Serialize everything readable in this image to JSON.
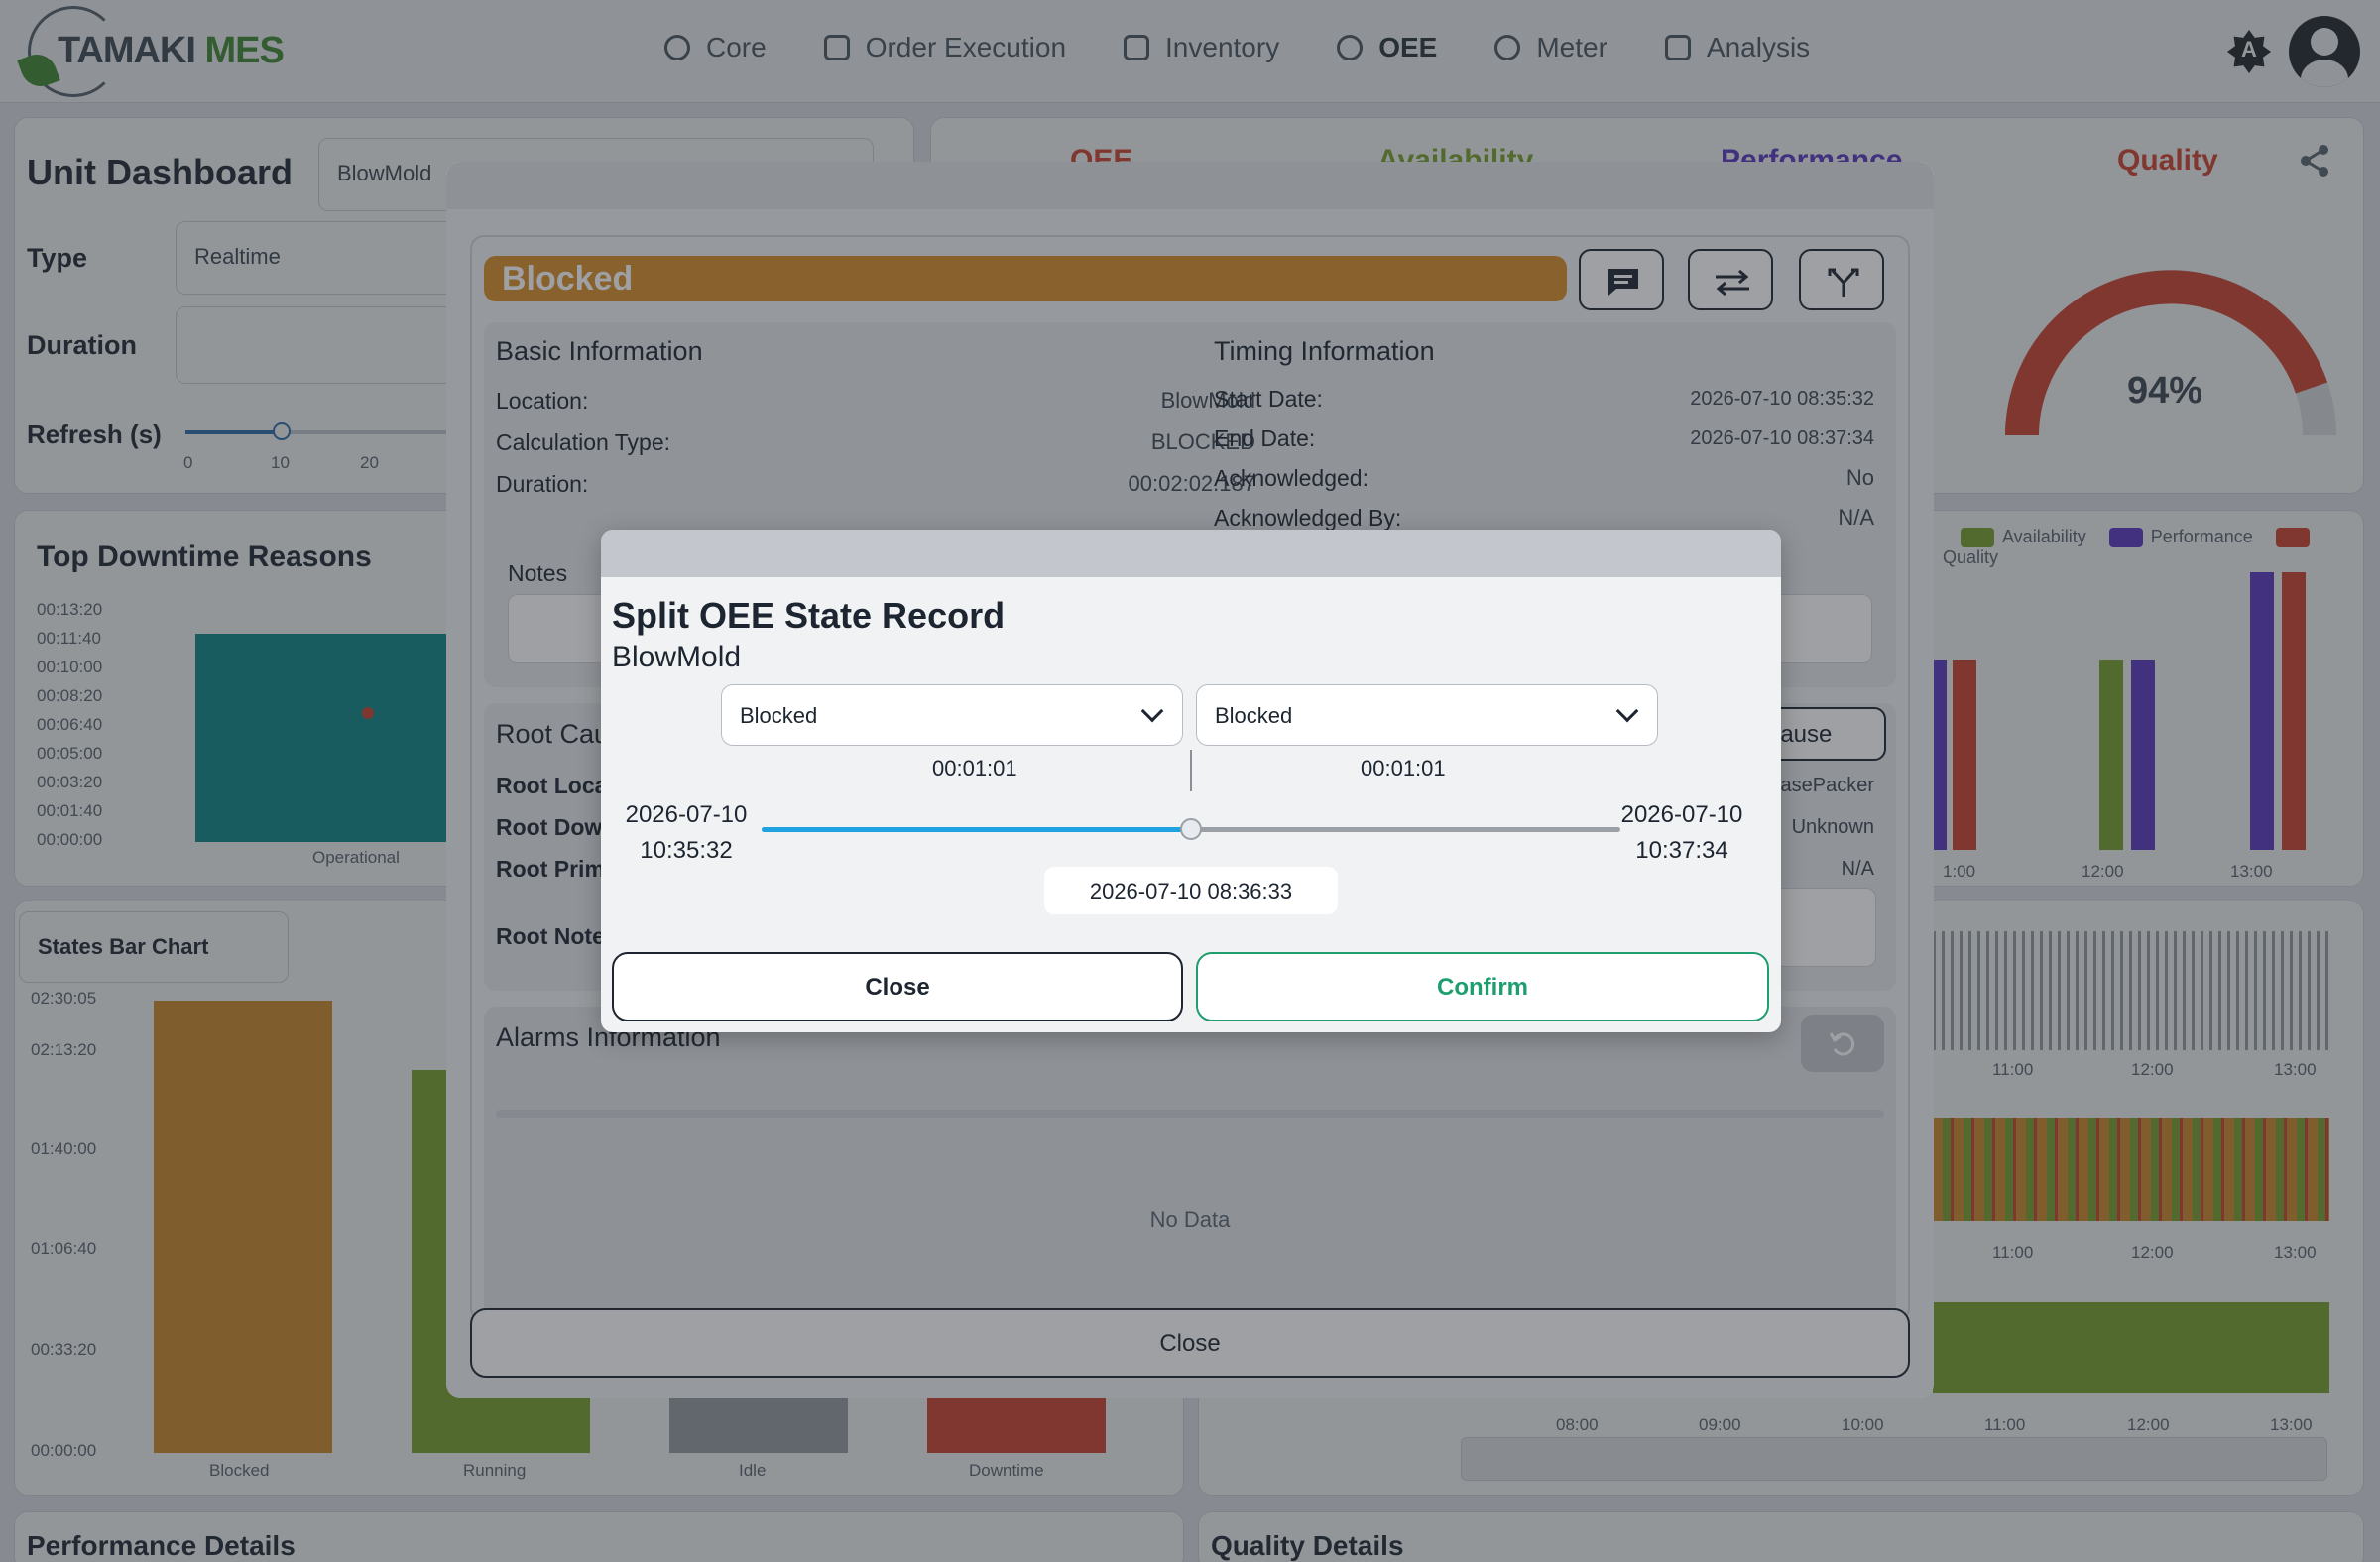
{
  "app": {
    "brand_left": "TAMAKI",
    "brand_right": "MES",
    "theme_badge": "A"
  },
  "nav": [
    {
      "label": "Core",
      "icon": "gear-icon"
    },
    {
      "label": "Order Execution",
      "icon": "calendar-icon"
    },
    {
      "label": "Inventory",
      "icon": "boxes-icon"
    },
    {
      "label": "OEE",
      "icon": "gauge-icon",
      "active": true
    },
    {
      "label": "Meter",
      "icon": "timer-icon"
    },
    {
      "label": "Analysis",
      "icon": "chart-icon"
    }
  ],
  "dashboard": {
    "title": "Unit Dashboard",
    "unit_value": "BlowMold",
    "type_label": "Type",
    "type_value": "Realtime",
    "duration_label": "Duration",
    "refresh_label": "Refresh (s)",
    "refresh_ticks": [
      "0",
      "10",
      "20"
    ],
    "refresh_value": 10,
    "tabs": [
      "OEE",
      "Availability",
      "Performance",
      "Quality"
    ],
    "quality_gauge": "94%",
    "downtime_title": "Top Downtime Reasons",
    "downtime_ticks": [
      "00:13:20",
      "00:11:40",
      "00:10:00",
      "00:08:20",
      "00:06:40",
      "00:05:00",
      "00:03:20",
      "00:01:40",
      "00:00:00"
    ],
    "downtime_category": "Operational",
    "states_select": "States Bar Chart",
    "states_ticks": [
      "02:30:05",
      "02:13:20",
      "01:40:00",
      "01:06:40",
      "00:33:20",
      "00:00:00"
    ],
    "states_categories": [
      "Blocked",
      "Running",
      "Idle",
      "Downtime"
    ],
    "legend": [
      "Availability",
      "Performance",
      "Quality"
    ],
    "time_ticks_a": [
      "1:00",
      "12:00",
      "13:00"
    ],
    "time_ticks_b": [
      "11:00",
      "12:00",
      "13:00"
    ],
    "time_ticks_c": [
      "08:00",
      "09:00",
      "10:00",
      "11:00",
      "12:00",
      "13:00"
    ],
    "perf_details": "Performance Details",
    "quality_details": "Quality Details"
  },
  "record": {
    "state": "Blocked",
    "basic_title": "Basic Information",
    "timing_title": "Timing Information",
    "location_label": "Location:",
    "location": "BlowMold",
    "calc_label": "Calculation Type:",
    "calc": "BLOCKED",
    "duration_label": "Duration:",
    "duration": "00:02:02.187",
    "start_label": "Start Date:",
    "start": "2026-07-10 08:35:32",
    "end_label": "End Date:",
    "end": "2026-07-10 08:37:34",
    "ack_label": "Acknowledged:",
    "ack": "No",
    "ackby_label": "Acknowledged By:",
    "ackby": "N/A",
    "notes_label": "Notes",
    "root_title": "Root Cau",
    "root_cause_btn": "Cause",
    "root_loc_label": "Root Loca",
    "root_loc": "/CasePacker",
    "root_down_label": "Root Dow",
    "root_down": "Unknown",
    "root_prim_label": "Root Prim",
    "root_prim": "N/A",
    "root_note_label": "Root Note",
    "alarms_title": "Alarms Information",
    "no_data": "No Data",
    "close": "Close"
  },
  "split": {
    "title": "Split OEE State Record",
    "subtitle": "BlowMold",
    "left_state": "Blocked",
    "right_state": "Blocked",
    "left_duration": "00:01:01",
    "right_duration": "00:01:01",
    "range_start_date": "2026-07-10",
    "range_start_time": "10:35:32",
    "range_end_date": "2026-07-10",
    "range_end_time": "10:37:34",
    "split_fraction": 0.5,
    "split_time": "2026-07-10 08:36:33",
    "close": "Close",
    "confirm": "Confirm"
  },
  "colors": {
    "blocked": "#d98d27",
    "running": "#7fa62a",
    "idle": "#9aa0a6",
    "downtime": "#d8402a",
    "teal": "#0b8a8a",
    "availability": "#7fa62a",
    "performance": "#5b34c8",
    "quality": "#d8402a",
    "confirm": "#1e9e6e",
    "slider": "#1fa3e0"
  }
}
